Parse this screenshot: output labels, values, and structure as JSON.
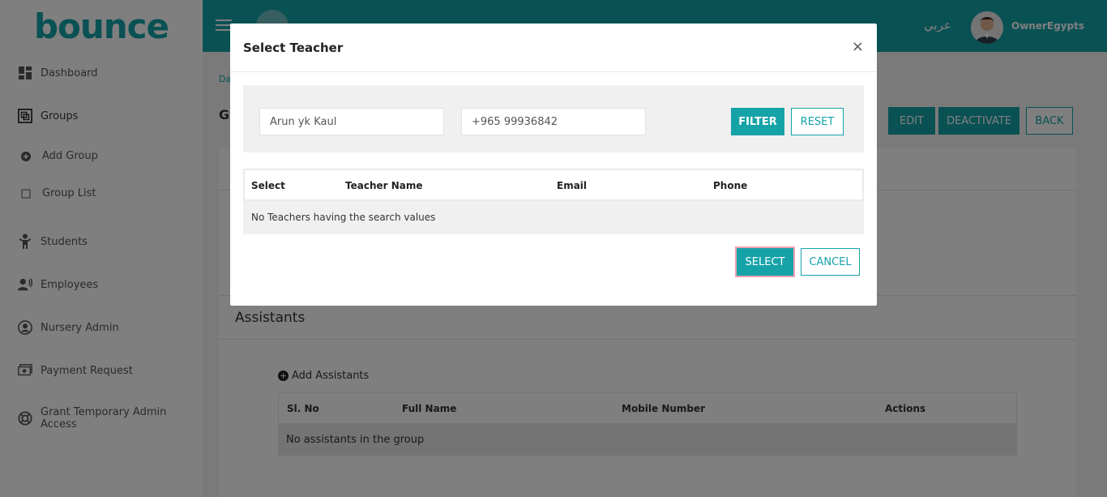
{
  "logo": {
    "text": "bounce"
  },
  "sidebar": {
    "items": [
      {
        "label": "Dashboard",
        "icon": "dashboard-icon"
      },
      {
        "label": "Groups",
        "icon": "groups-icon"
      },
      {
        "label": "Add Group",
        "icon": "plus-circle-icon"
      },
      {
        "label": "Group List",
        "icon": "square-icon"
      },
      {
        "label": "Students",
        "icon": "student-icon"
      },
      {
        "label": "Employees",
        "icon": "employees-icon"
      },
      {
        "label": "Nursery Admin",
        "icon": "user-circle-icon"
      },
      {
        "label": "Payment Request",
        "icon": "payment-icon"
      },
      {
        "label": "Grant Temporary Admin Access",
        "icon": "lifebuoy-icon"
      }
    ]
  },
  "header": {
    "lang": "عربي",
    "username": "OwnerEgypts",
    "accent": "#15a3a8"
  },
  "main": {
    "breadcrumb": "Da",
    "title": "Gr",
    "buttons": {
      "edit": "EDIT",
      "deactivate": "DEACTIVATE",
      "back": "BACK"
    },
    "assistants": {
      "title": "Assistants",
      "add_label": "Add Assistants",
      "columns": [
        "Sl. No",
        "Full Name",
        "Mobile Number",
        "Actions"
      ],
      "empty": "No assistants in the group"
    }
  },
  "modal": {
    "title": "Select Teacher",
    "close": "×",
    "name_value": "Arun yk Kaul",
    "phone_value": "+965 99936842",
    "filter_label": "FILTER",
    "reset_label": "RESET",
    "columns": [
      "Select",
      "Teacher Name",
      "Email",
      "Phone"
    ],
    "empty": "No Teachers having the search values",
    "select_label": "SELECT",
    "cancel_label": "CANCEL"
  }
}
